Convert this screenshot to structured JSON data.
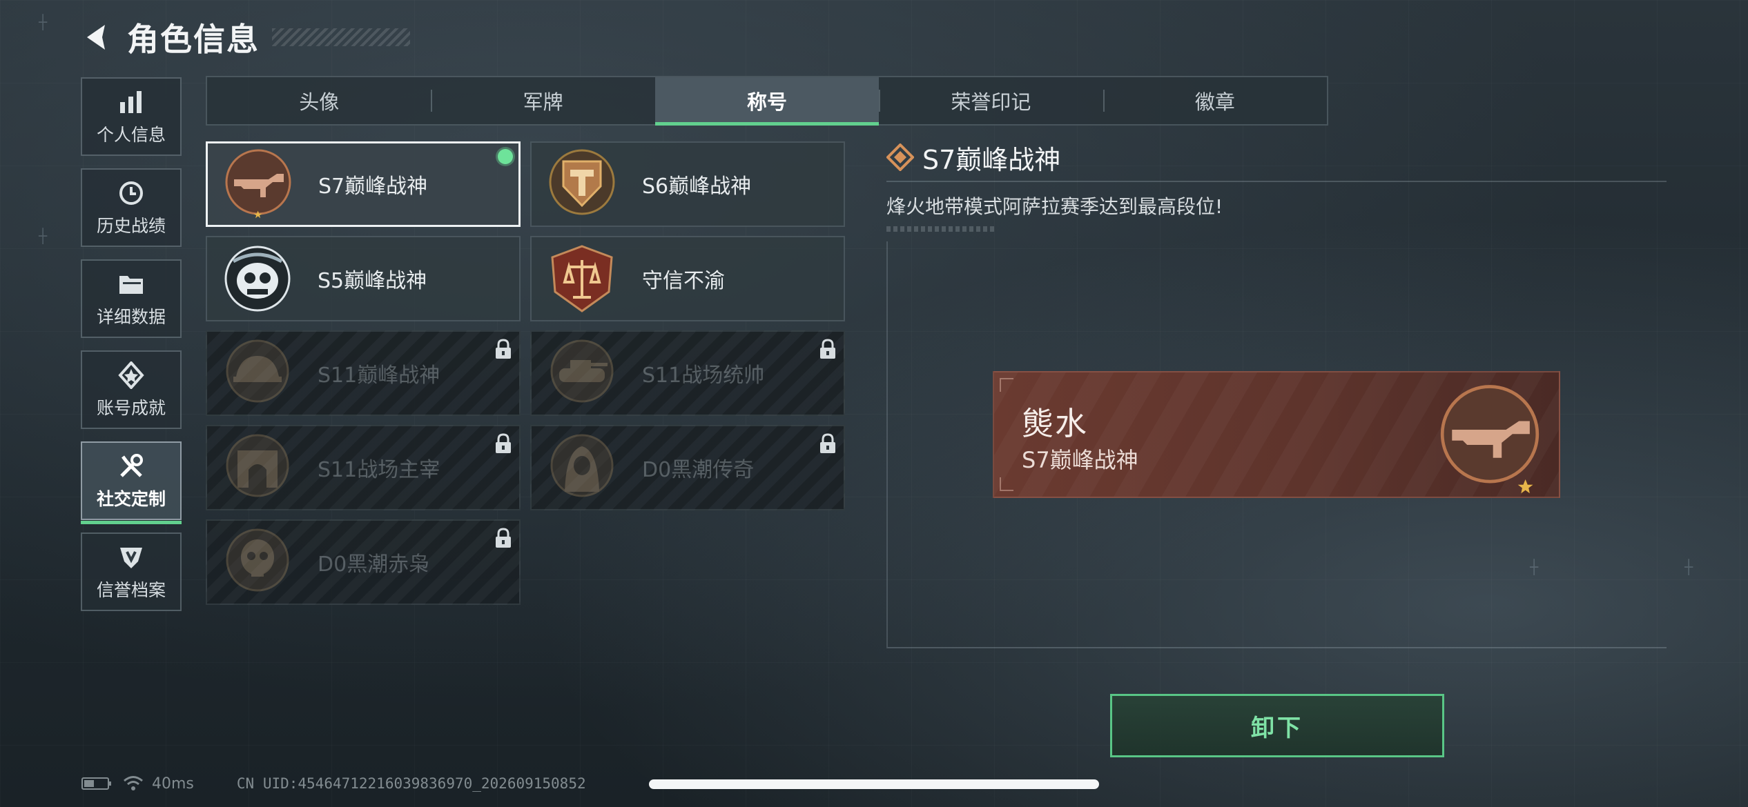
{
  "header": {
    "title": "角色信息"
  },
  "sidebar": {
    "items": [
      {
        "label": "个人信息",
        "icon": "bar-chart-icon"
      },
      {
        "label": "历史战绩",
        "icon": "history-clock-icon"
      },
      {
        "label": "详细数据",
        "icon": "folder-icon"
      },
      {
        "label": "账号成就",
        "icon": "achievement-medal-icon"
      },
      {
        "label": "社交定制",
        "icon": "tools-icon",
        "active": true
      },
      {
        "label": "信誉档案",
        "icon": "shield-emblem-icon"
      }
    ]
  },
  "tabs": [
    {
      "label": "头像"
    },
    {
      "label": "军牌"
    },
    {
      "label": "称号",
      "active": true
    },
    {
      "label": "荣誉印记"
    },
    {
      "label": "徽章"
    }
  ],
  "titles": [
    {
      "name": "S7巅峰战神",
      "state": "equipped"
    },
    {
      "name": "S6巅峰战神",
      "state": "owned"
    },
    {
      "name": "S5巅峰战神",
      "state": "owned"
    },
    {
      "name": "守信不渝",
      "state": "owned"
    },
    {
      "name": "S11巅峰战神",
      "state": "locked"
    },
    {
      "name": "S11战场统帅",
      "state": "locked"
    },
    {
      "name": "S11战场主宰",
      "state": "locked"
    },
    {
      "name": "D0黑潮传奇",
      "state": "locked"
    },
    {
      "name": "D0黑潮赤枭",
      "state": "locked"
    }
  ],
  "detail": {
    "title": "S7巅峰战神",
    "description": "烽火地带模式阿萨拉赛季达到最高段位!"
  },
  "nameplate": {
    "player_name": "熋水",
    "title": "S7巅峰战神"
  },
  "actions": {
    "unequip_label": "卸下"
  },
  "status": {
    "latency": "40ms",
    "uid": "CN UID:4546471221603983697​0_202609150852"
  },
  "colors": {
    "accent_green": "#62d08e",
    "nameplate_red": "#6a3a30",
    "bronze": "#b8764e"
  }
}
